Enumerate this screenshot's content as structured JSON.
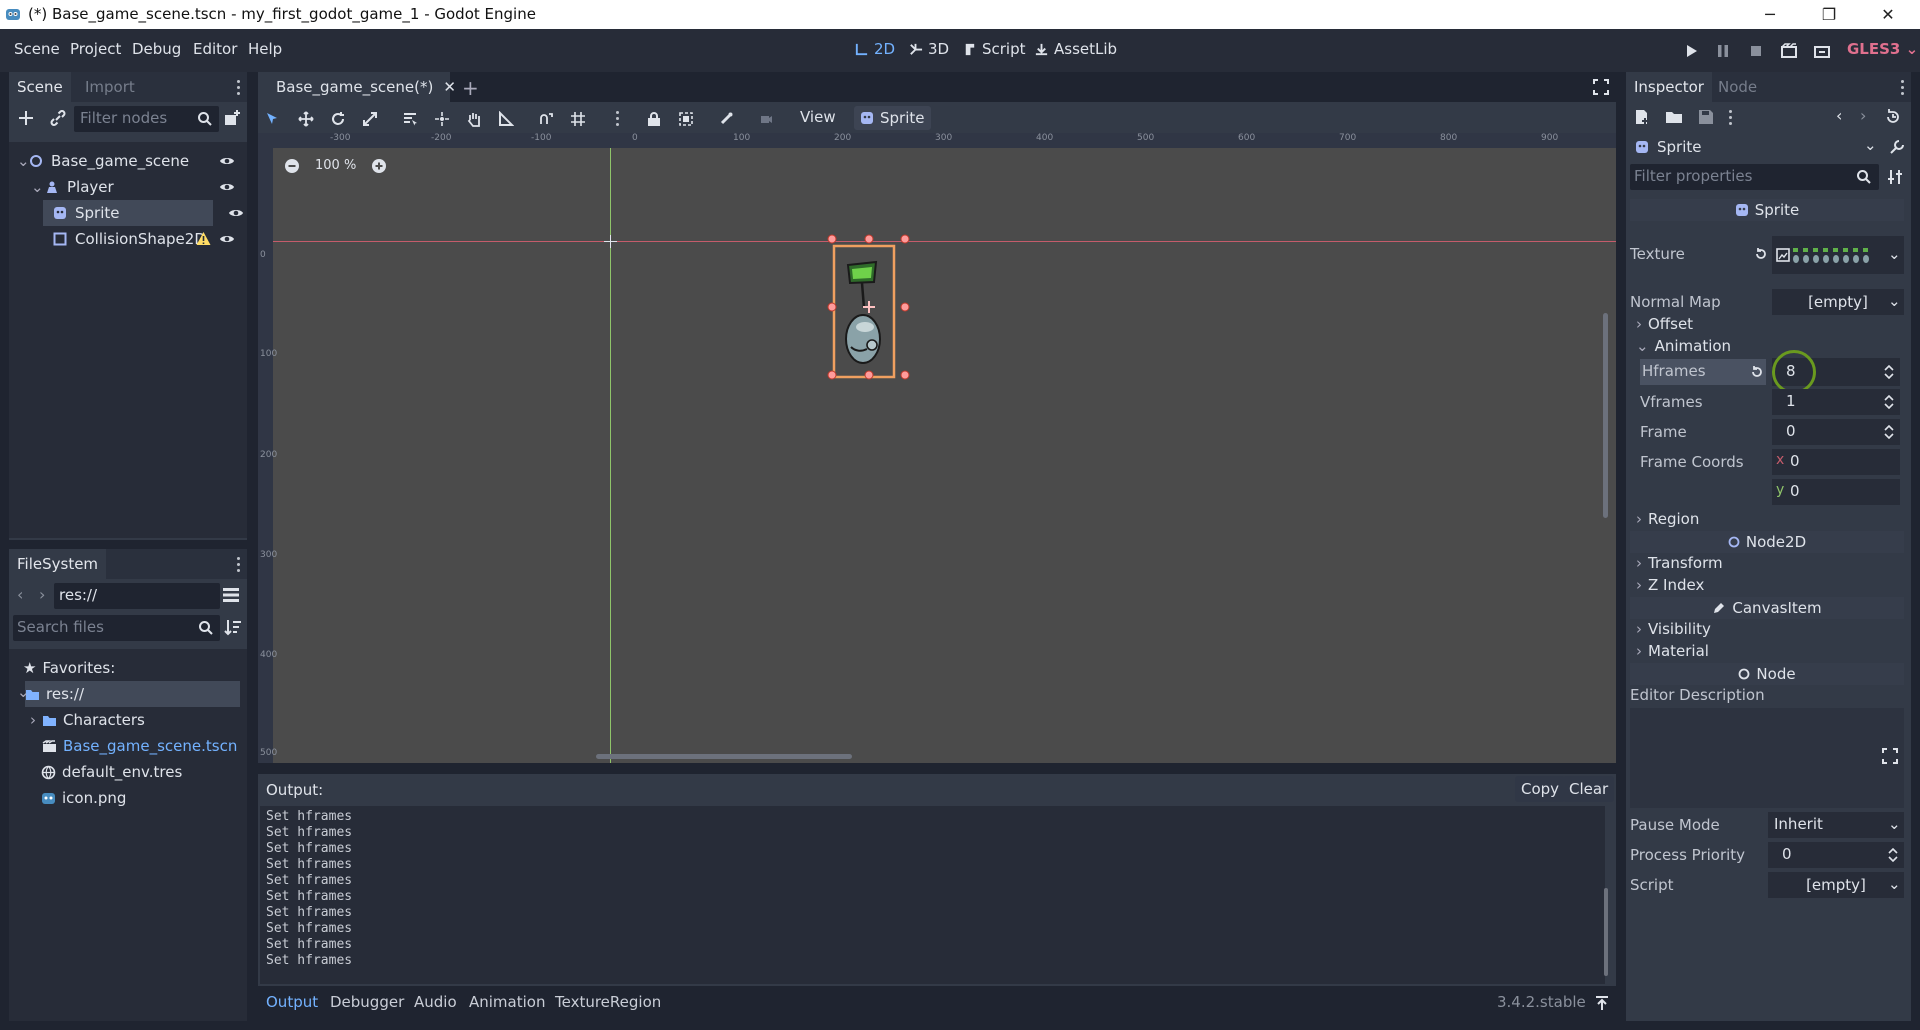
{
  "window": {
    "title": "(*) Base_game_scene.tscn - my_first_godot_game_1 - Godot Engine",
    "minimize": "─",
    "restore": "❐",
    "close": "✕"
  },
  "menu": {
    "items": [
      "Scene",
      "Project",
      "Debug",
      "Editor",
      "Help"
    ],
    "workspaces": [
      {
        "label": "2D",
        "active": true
      },
      {
        "label": "3D",
        "active": false
      },
      {
        "label": "Script",
        "active": false
      },
      {
        "label": "AssetLib",
        "active": false
      }
    ],
    "renderer": "GLES3"
  },
  "scene_dock": {
    "tabs": [
      "Scene",
      "Import"
    ],
    "filter_placeholder": "Filter nodes",
    "nodes": [
      {
        "label": "Base_game_scene",
        "icon": "node2d-icon",
        "depth": 0
      },
      {
        "label": "Player",
        "icon": "kinematic-body-icon",
        "depth": 1
      },
      {
        "label": "Sprite",
        "icon": "sprite-icon",
        "depth": 2,
        "selected": true
      },
      {
        "label": "CollisionShape2D",
        "icon": "collision-shape-icon",
        "depth": 2,
        "warning": true
      }
    ]
  },
  "filesystem_dock": {
    "tab": "FileSystem",
    "path": "res://",
    "search_placeholder": "Search files",
    "favorites_label": "Favorites:",
    "items": [
      {
        "label": "res://",
        "icon": "folder-icon",
        "depth": 0,
        "selected": true
      },
      {
        "label": "Characters",
        "icon": "folder-icon",
        "depth": 1
      },
      {
        "label": "Base_game_scene.tscn",
        "icon": "scene-file-icon",
        "depth": 1,
        "highlight": true
      },
      {
        "label": "default_env.tres",
        "icon": "environment-icon",
        "depth": 1
      },
      {
        "label": "icon.png",
        "icon": "image-icon",
        "depth": 1
      }
    ]
  },
  "editor": {
    "scene_tab": "Base_game_scene(*)",
    "zoom": "100 %",
    "toolbar": {
      "view_label": "View",
      "sprite_label": "Sprite"
    },
    "ruler_h": [
      "-300",
      "-200",
      "-100",
      "0",
      "100",
      "200",
      "300",
      "400",
      "500",
      "600",
      "700",
      "800",
      "900"
    ],
    "ruler_v": [
      "0",
      "100",
      "200",
      "300",
      "400",
      "500"
    ]
  },
  "output": {
    "title": "Output:",
    "copy_label": "Copy",
    "clear_label": "Clear",
    "lines": [
      "Set hframes",
      "Set hframes",
      "Set hframes",
      "Set hframes",
      "Set hframes",
      "Set hframes",
      "Set hframes",
      "Set hframes",
      "Set hframes",
      "Set hframes"
    ],
    "bottom_tabs": [
      "Output",
      "Debugger",
      "Audio",
      "Animation",
      "TextureRegion"
    ],
    "version": "3.4.2.stable"
  },
  "inspector": {
    "tabs": [
      "Inspector",
      "Node"
    ],
    "object_name": "Sprite",
    "filter_placeholder": "Filter properties",
    "sprite_section": "Sprite",
    "texture_label": "Texture",
    "normal_map_label": "Normal Map",
    "normal_map_value": "[empty]",
    "offset_label": "Offset",
    "animation_label": "Animation",
    "hframes_label": "Hframes",
    "hframes_value": "8",
    "vframes_label": "Vframes",
    "vframes_value": "1",
    "frame_label": "Frame",
    "frame_value": "0",
    "frame_coords_label": "Frame Coords",
    "frame_coords_x_axis": "x",
    "frame_coords_x": "0",
    "frame_coords_y_axis": "y",
    "frame_coords_y": "0",
    "region_label": "Region",
    "node2d_section": "Node2D",
    "transform_label": "Transform",
    "zindex_label": "Z Index",
    "canvasitem_section": "CanvasItem",
    "visibility_label": "Visibility",
    "material_label": "Material",
    "node_section": "Node",
    "editor_description_label": "Editor Description",
    "pause_mode_label": "Pause Mode",
    "pause_mode_value": "Inherit",
    "process_priority_label": "Process Priority",
    "process_priority_value": "0",
    "script_label": "Script",
    "script_value": "[empty]"
  },
  "colors": {
    "accent": "#73b2ff",
    "renderer": "#e0708e",
    "highlight_ring": "#6a9a1f",
    "selection_box": "#f0a060",
    "x_axis": "#c45c6b",
    "y_axis": "#8fc46a"
  }
}
